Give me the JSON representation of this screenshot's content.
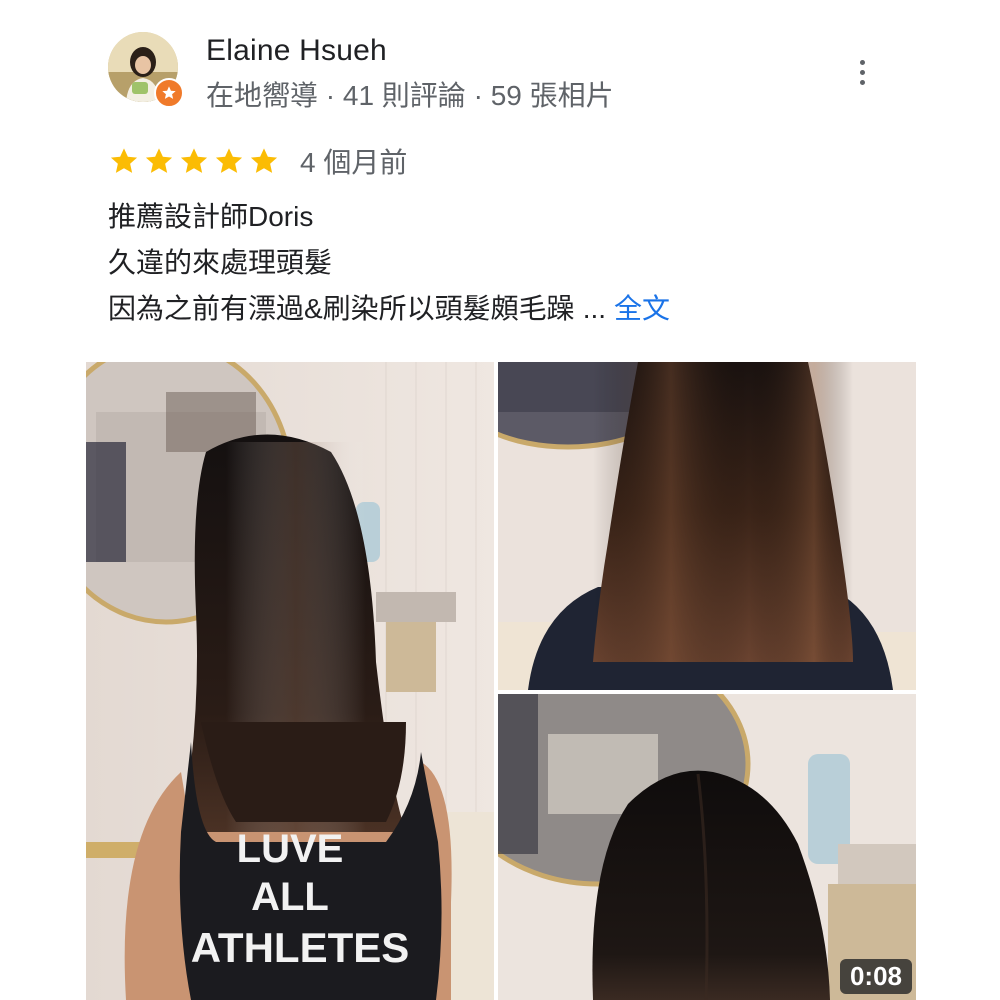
{
  "reviewer": {
    "name": "Elaine Hsueh",
    "meta": "在地嚮導 · 41 則評論 · 59 張相片",
    "avatar_icon": "avatar-photo",
    "badge_icon": "local-guide-star-icon"
  },
  "menu": {
    "icon": "more-vert-icon"
  },
  "rating": {
    "stars": 5,
    "max": 5,
    "star_color": "#fbbc04",
    "date": "4 個月前"
  },
  "review": {
    "lines": [
      "推薦設計師Doris",
      "久違的來處理頭髮",
      "因為之前有漂過&刷染所以頭髮頗毛躁"
    ],
    "ellipsis": "...",
    "more_label": "全文",
    "link_color": "#1a73e8"
  },
  "photos": {
    "main_shirt_text": [
      "LUVE",
      "ALL",
      "ATHLETES"
    ],
    "video_duration": "0:08"
  }
}
